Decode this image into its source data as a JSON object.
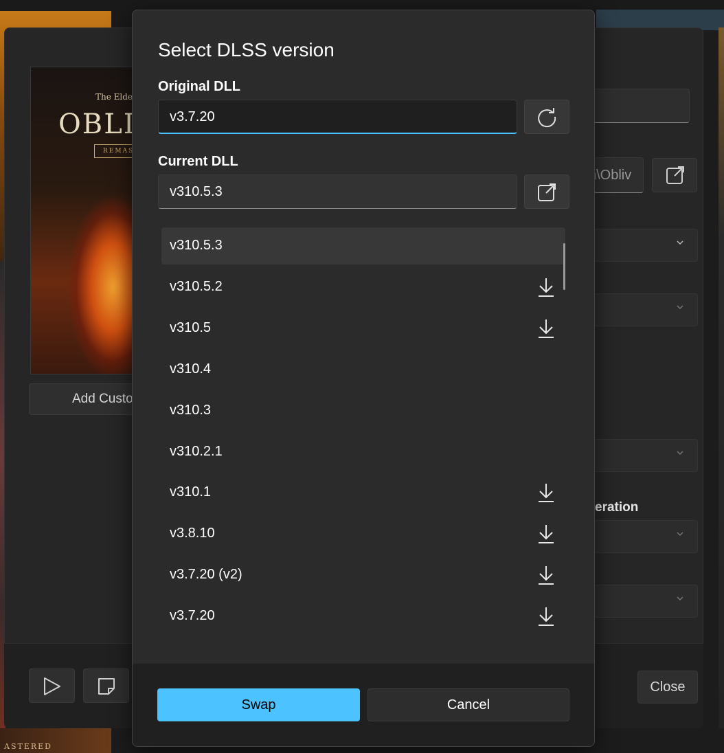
{
  "background": {
    "cover": {
      "subtitle": "The Elder",
      "title": "OBLIV",
      "badge": "REMAS"
    },
    "bottom_tile_text": "ASTERED",
    "add_custom_label": "Add Custo",
    "path_fragment": "n\\Obliv",
    "section_label": "eration",
    "close_label": "Close"
  },
  "dialog": {
    "title": "Select DLSS version",
    "original_dll": {
      "label": "Original DLL",
      "value": "v3.7.20"
    },
    "current_dll": {
      "label": "Current DLL",
      "value": "v310.5.3"
    },
    "versions": [
      {
        "label": "v310.5.3",
        "selected": true,
        "download": false
      },
      {
        "label": "v310.5.2",
        "selected": false,
        "download": true
      },
      {
        "label": "v310.5",
        "selected": false,
        "download": true
      },
      {
        "label": "v310.4",
        "selected": false,
        "download": false
      },
      {
        "label": "v310.3",
        "selected": false,
        "download": false
      },
      {
        "label": "v310.2.1",
        "selected": false,
        "download": false
      },
      {
        "label": "v310.1",
        "selected": false,
        "download": true
      },
      {
        "label": "v3.8.10",
        "selected": false,
        "download": true
      },
      {
        "label": "v3.7.20 (v2)",
        "selected": false,
        "download": true
      },
      {
        "label": "v3.7.20",
        "selected": false,
        "download": true
      }
    ],
    "swap_label": "Swap",
    "cancel_label": "Cancel"
  },
  "colors": {
    "accent": "#4cc2ff",
    "dialog_bg": "#2b2b2b",
    "selected_row": "#383838"
  }
}
